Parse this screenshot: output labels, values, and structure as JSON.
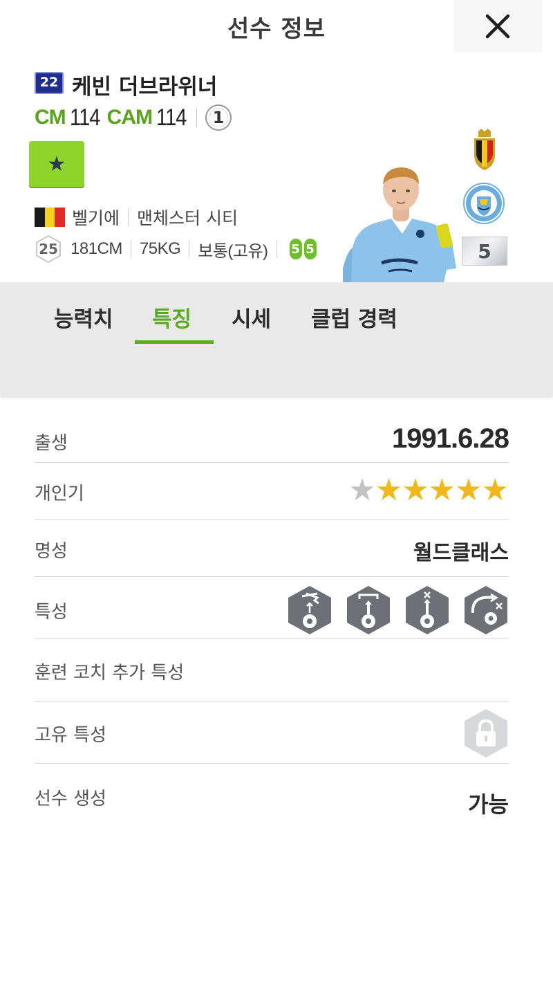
{
  "header": {
    "title": "선수 정보",
    "close_icon": "close-icon"
  },
  "player": {
    "season_badge": "22",
    "name": "케빈 더브라위너",
    "positions": [
      {
        "pos": "CM",
        "ovr": "114"
      },
      {
        "pos": "CAM",
        "ovr": "114"
      }
    ],
    "enhance_level": "1",
    "star_button_icon": "star-icon",
    "nation": "벨기에",
    "club": "맨체스터 시티",
    "age": "25",
    "height": "181CM",
    "weight": "75KG",
    "body_type": "보통(고유)",
    "skill_moves": [
      "5",
      "5"
    ],
    "grade": "5"
  },
  "tabs": [
    {
      "label": "능력치",
      "active": false
    },
    {
      "label": "특징",
      "active": true
    },
    {
      "label": "시세",
      "active": false
    },
    {
      "label": "클럽 경력",
      "active": false
    }
  ],
  "info": {
    "birth": {
      "label": "출생",
      "value": "1991.6.28"
    },
    "popularity": {
      "label": "개인기",
      "stars_filled": 5,
      "stars_total": 6
    },
    "reputation": {
      "label": "명성",
      "value": "월드클래스"
    },
    "traits": {
      "label": "특성",
      "icons": [
        "trait-long-shot-icon",
        "trait-power-header-icon",
        "trait-long-pass-icon",
        "trait-curve-pass-icon"
      ]
    },
    "coach_traits": {
      "label": "훈련 코치 추가 특성"
    },
    "unique_traits": {
      "label": "고유 특성",
      "icon": "lock-icon"
    },
    "create": {
      "label": "선수 생성",
      "value": "가능"
    }
  },
  "colors": {
    "accent_green": "#59a81d",
    "star_gold": "#f0b81c",
    "star_gray": "#c3c3c3",
    "trait_gray": "#6d7177"
  }
}
